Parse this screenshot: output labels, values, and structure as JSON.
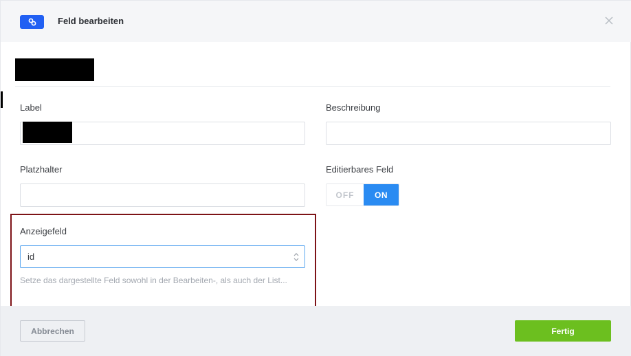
{
  "header": {
    "title": "Feld bearbeiten",
    "badge_icon": "link-icon",
    "close_icon": "close-icon"
  },
  "form": {
    "label": {
      "title": "Label",
      "value": ""
    },
    "description": {
      "title": "Beschreibung",
      "value": ""
    },
    "placeholder": {
      "title": "Platzhalter",
      "value": ""
    },
    "editable": {
      "title": "Editierbares Feld",
      "off_label": "OFF",
      "on_label": "ON",
      "state": "ON"
    },
    "display_field": {
      "title": "Anzeigefeld",
      "selected": "id",
      "hint": "Setze das dargestellte Feld sowohl in der Bearbeiten-, als auch der List..."
    }
  },
  "footer": {
    "cancel_label": "Abbrechen",
    "done_label": "Fertig"
  },
  "colors": {
    "accent_blue": "#2a8bf2",
    "badge_blue": "#2160f3",
    "done_green": "#6cbf1f",
    "highlight_red": "#7d1317"
  }
}
